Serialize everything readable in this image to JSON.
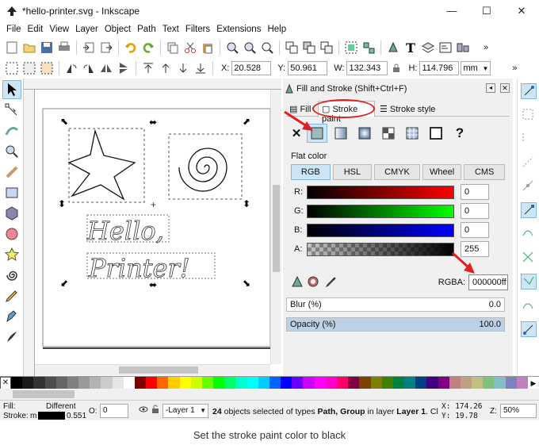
{
  "window": {
    "title": "*hello-printer.svg - Inkscape",
    "min": "—",
    "max": "☐",
    "close": "✕"
  },
  "menu": [
    "File",
    "Edit",
    "View",
    "Layer",
    "Object",
    "Path",
    "Text",
    "Filters",
    "Extensions",
    "Help"
  ],
  "coords": {
    "x_label": "X:",
    "x": "20.528",
    "y_label": "Y:",
    "y": "50.961",
    "w_label": "W:",
    "w": "132.343",
    "h_label": "H:",
    "h": "114.796",
    "unit": "mm"
  },
  "canvas": {
    "text_line1": "Hello,",
    "text_line2": "Printer!"
  },
  "dialog": {
    "title": "Fill and Stroke (Shift+Ctrl+F)",
    "tabs": [
      "Fill",
      "Stroke paint",
      "Stroke style"
    ],
    "flat_color": "Flat color",
    "modes": [
      "RGB",
      "HSL",
      "CMYK",
      "Wheel",
      "CMS"
    ],
    "channels": [
      {
        "label": "R:",
        "value": "0"
      },
      {
        "label": "G:",
        "value": "0"
      },
      {
        "label": "B:",
        "value": "0"
      },
      {
        "label": "A:",
        "value": "255"
      }
    ],
    "rgba_label": "RGBA:",
    "rgba": "000000ff",
    "blur_label": "Blur (%)",
    "blur": "0.0",
    "opacity_label": "Opacity (%)",
    "opacity": "100.0",
    "question": "?"
  },
  "status": {
    "fill_label": "Fill:",
    "fill_value": "Different",
    "stroke_label": "Stroke:",
    "stroke_value": "m",
    "stroke_width": "0.551",
    "o_label": "O:",
    "o_value": "0",
    "layer": "-Layer 1",
    "message_bold": "24",
    "message": " objects selected of types ",
    "msg_types": "Path, Group",
    "msg_in": " in layer ",
    "msg_layer": "Layer 1",
    "msg_tail": ". Cl...",
    "x_label": "X:",
    "x": "174.26",
    "y_label": "Y:",
    "y": "19.78",
    "z_label": "Z:",
    "zoom": "50%"
  },
  "palette_colors": [
    "#000000",
    "#1a1a1a",
    "#333333",
    "#4d4d4d",
    "#666666",
    "#808080",
    "#999999",
    "#b3b3b3",
    "#cccccc",
    "#e6e6e6",
    "#ffffff",
    "#800000",
    "#ff0000",
    "#ff6600",
    "#ffcc00",
    "#ffff00",
    "#ccff00",
    "#66ff00",
    "#00ff00",
    "#00ff66",
    "#00ffcc",
    "#00ffff",
    "#00ccff",
    "#0066ff",
    "#0000ff",
    "#6600ff",
    "#cc00ff",
    "#ff00ff",
    "#ff00cc",
    "#ff0066",
    "#800040",
    "#804000",
    "#808000",
    "#408000",
    "#008040",
    "#008080",
    "#004080",
    "#400080",
    "#800080",
    "#c08080",
    "#c0a080",
    "#c0c080",
    "#80c080",
    "#80c0c0",
    "#8080c0",
    "#c080c0"
  ],
  "caption": "Set the stroke paint color to black"
}
